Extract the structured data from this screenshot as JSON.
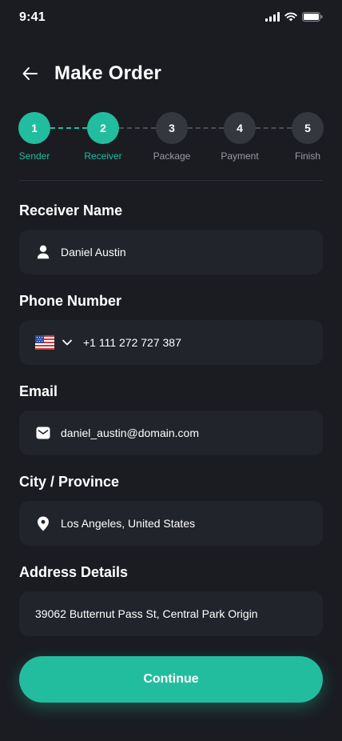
{
  "status_bar": {
    "time": "9:41"
  },
  "header": {
    "title": "Make Order"
  },
  "stepper": {
    "steps": [
      {
        "number": "1",
        "label": "Sender"
      },
      {
        "number": "2",
        "label": "Receiver"
      },
      {
        "number": "3",
        "label": "Package"
      },
      {
        "number": "4",
        "label": "Payment"
      },
      {
        "number": "5",
        "label": "Finish"
      }
    ],
    "current_step": 2
  },
  "form": {
    "receiver_name": {
      "label": "Receiver Name",
      "value": "Daniel Austin",
      "icon": "person-icon"
    },
    "phone": {
      "label": "Phone Number",
      "value": "+1 111 272 727 387",
      "country_flag": "us-flag-icon"
    },
    "email": {
      "label": "Email",
      "value": "daniel_austin@domain.com",
      "icon": "mail-icon"
    },
    "city": {
      "label": "City / Province",
      "value": "Los Angeles, United States",
      "icon": "location-pin-icon"
    },
    "address": {
      "label": "Address Details",
      "value": "39062 Butternut Pass St, Central Park Origin"
    }
  },
  "continue_label": "Continue",
  "colors": {
    "accent": "#22bd9f",
    "background": "#1a1c22",
    "field": "#22242b",
    "inactive_step": "#35373e"
  }
}
